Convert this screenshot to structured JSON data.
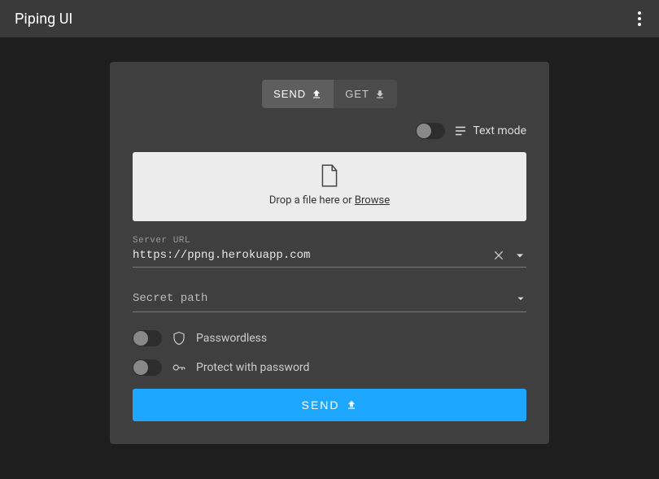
{
  "app": {
    "title": "Piping UI"
  },
  "mode": {
    "send_label": "SEND",
    "get_label": "GET",
    "active": "send"
  },
  "text_mode": {
    "label": "Text mode",
    "enabled": false
  },
  "drop_zone": {
    "text_prefix": "Drop a file here or ",
    "browse_label": "Browse"
  },
  "server_url": {
    "label": "Server URL",
    "value": "https://ppng.herokuapp.com"
  },
  "secret_path": {
    "placeholder": "Secret path",
    "value": ""
  },
  "options": {
    "passwordless": {
      "label": "Passwordless",
      "enabled": false
    },
    "protect_password": {
      "label": "Protect with password",
      "enabled": false
    }
  },
  "submit": {
    "label": "SEND"
  }
}
